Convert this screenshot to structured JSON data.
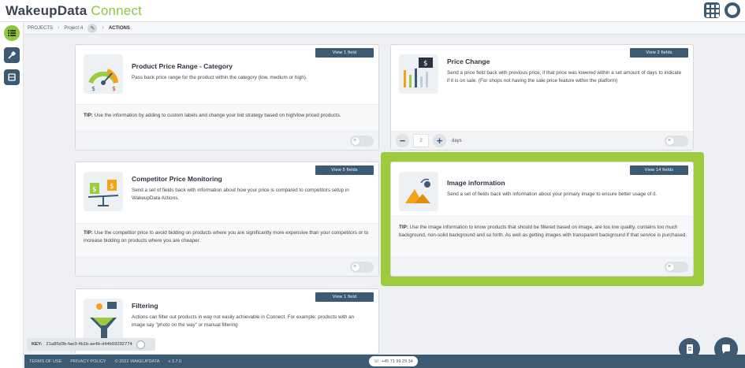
{
  "app": {
    "logo_main": "WakeupData",
    "logo_accent": "Connect"
  },
  "breadcrumb": {
    "projects": "PROJECTS",
    "project": "Project A",
    "current": "ACTIONS"
  },
  "cards": [
    {
      "title": "Product Price Range - Category",
      "view_label": "View 1 field",
      "description": "Pass back price range for the product within the category (low, medium or high).",
      "tip_label": "TIP:",
      "tip": "Use the information by adding to custom labels and change your bid strategy based on high/low priced products."
    },
    {
      "title": "Price Change",
      "view_label": "View 2 fields",
      "description": "Send a price field back with previous price, if that price was lowered within a set amount of days to indicate if it is on sale. (For shops not having the sale price feature within the platform)",
      "stepper_value": "2",
      "stepper_unit": "days"
    },
    {
      "title": "Competitor Price Monitoring",
      "view_label": "View 5 fields",
      "description": "Send a set of fields back with information about how your price is compared to competitors setup in WakeupData Actions.",
      "tip_label": "TIP:",
      "tip": "Use the competitor price to avoid bidding on products where you are significantly more expensive than your competitors or to increase bidding on products where you are cheaper."
    },
    {
      "title": "Image information",
      "view_label": "View 14 fields",
      "description": "Send a set of fields back with information about your primary image to ensure better usage of it.",
      "tip_label": "TIP:",
      "tip": "Use the image information to know products that should be filtered based on image, are too low quality, contains too much background, non-solid background and so forth. As well as getting images with transparent background if that service is purchased."
    },
    {
      "title": "Filtering",
      "view_label": "View 1 field",
      "description": "Actions can filter out products in way not easily achievable in Connect. For example: products with an image say \"photo on the way\" or manual filtering"
    }
  ],
  "key": {
    "label": "KEY:",
    "value": "21a85d3b-fae3-4b1b-ae4b-d44b59292774"
  },
  "footer": {
    "terms": "TERMS OF USE",
    "privacy": "PRIVACY POLICY",
    "copyright": "© 2022 WAKEUPDATA",
    "version": "v 3.7.0",
    "phone": "+45 71 99 29 34"
  },
  "colors": {
    "brand_dark": "#3d5a73",
    "brand_green": "#8cc63f",
    "highlight": "#9ccb3e"
  },
  "icons": {
    "sidebar": [
      "list-icon",
      "tools-icon",
      "database-icon"
    ],
    "top": [
      "apps-grid-icon",
      "user-avatar-icon"
    ],
    "fabs": [
      "log-icon",
      "chat-icon"
    ]
  }
}
